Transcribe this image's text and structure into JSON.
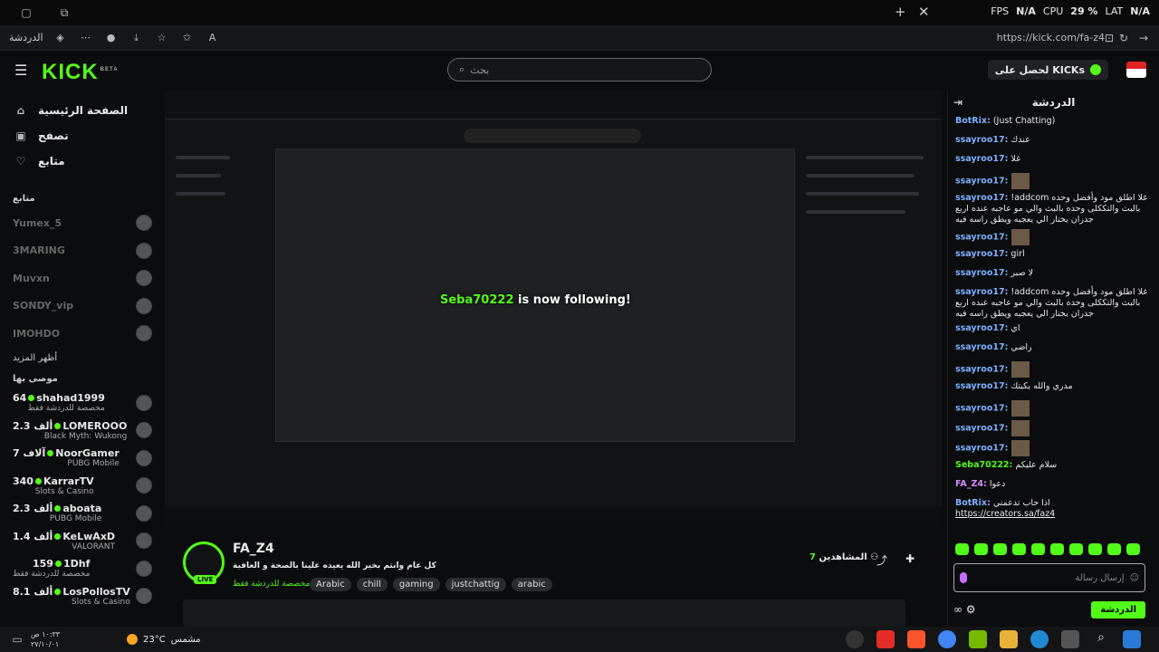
{
  "browser": {
    "tab_ctrl_labels": [
      "+",
      "✕"
    ],
    "hud": {
      "fps_label": "FPS",
      "fps_value": "N/A",
      "cpu_label": "CPU",
      "cpu_value": "29 %",
      "lat_label": "LAT",
      "lat_value": "N/A"
    },
    "chat_tab_label": "الدردشة",
    "url": "https://kick.com/fa-z4"
  },
  "header": {
    "logo_text": "KICK",
    "logo_sup": "BETA",
    "search_placeholder": "بحث",
    "get_kicks_label": "لحصل على KICKs"
  },
  "sidebar": {
    "nav": [
      {
        "label": "الصفحة الرئيسية",
        "icon": "home-icon"
      },
      {
        "label": "تصفح",
        "icon": "browse-icon"
      },
      {
        "label": "متابع",
        "icon": "heart-icon"
      }
    ],
    "following_title": "متابع",
    "following": [
      "Yumex_5",
      "3MARING",
      "Muvxn",
      "SONDY_vip",
      "IMOHDO"
    ],
    "show_more": "أظهر المزيد",
    "recommended_title": "موصى بها",
    "recommended": [
      {
        "name": "shahad1999",
        "count": "64",
        "category": "مخصصة للدردشة فقط"
      },
      {
        "name": "LOMEROOO",
        "count": "2.3 ألف",
        "category": "Black Myth: Wukong"
      },
      {
        "name": "NoorGamer",
        "count": "7 آلاف",
        "category": "PUBG Mobile"
      },
      {
        "name": "KarrarTV",
        "count": "340",
        "category": "Slots & Casino"
      },
      {
        "name": "aboata",
        "count": "2.3 ألف",
        "category": "PUBG Mobile"
      },
      {
        "name": "KeLwAxD",
        "count": "1.4 ألف",
        "category": "VALORANT"
      },
      {
        "name": "1Dhf",
        "count": "159",
        "category": "مخصصة للدردشة فقط"
      },
      {
        "name": "LosPollosTV",
        "count": "8.1 ألف",
        "category": "Slots & Casino"
      }
    ]
  },
  "stream": {
    "follow_user": "Seba70222",
    "follow_text": "is now following!"
  },
  "channel": {
    "name": "FA_Z4",
    "live_badge": "LIVE",
    "title": "كل عام وانتم بخير الله يعيده علينا بالصحة و العافية",
    "category": "مخصصة للدردشة فقط",
    "tags": [
      "Arabic",
      "chill",
      "gaming",
      "justchattig",
      "arabic"
    ],
    "viewers_label": "المشاهدين",
    "viewers_count": "7"
  },
  "chat": {
    "title": "الدردشة",
    "messages": [
      {
        "user": "BotRix:",
        "text": "(Just Chatting)",
        "color": "b"
      },
      {
        "user": "ssayroo17:",
        "text": "عندك",
        "color": "b"
      },
      {
        "user": "ssayroo17:",
        "text": "غلا",
        "color": "b"
      },
      {
        "user": "ssayroo17:",
        "text": "",
        "color": "b",
        "emote": true
      },
      {
        "user": "ssayroo17:",
        "text": "!addcom غلا اطلق مود وأفضل وحده بالبث والتككلى وحده بالبث والي مو عاجبه عنده اربع جدران يختار الي يعجبه ويطق راسه فيه",
        "color": "b"
      },
      {
        "user": "ssayroo17:",
        "text": "",
        "color": "b",
        "emote": true
      },
      {
        "user": "ssayroo17:",
        "text": "girl",
        "color": "b"
      },
      {
        "user": "ssayroo17:",
        "text": "لا صبر",
        "color": "b"
      },
      {
        "user": "ssayroo17:",
        "text": "!addcom غلا اطلق مود وأفضل وحده بالبث والتككلى وحده بالبث والي مو عاجبه عنده اربع جدران يختار الي يعجبه ويطق راسه فيه",
        "color": "b"
      },
      {
        "user": "ssayroo17:",
        "text": "اي",
        "color": "b"
      },
      {
        "user": "ssayroo17:",
        "text": "راضي",
        "color": "b"
      },
      {
        "user": "ssayroo17:",
        "text": "",
        "color": "b",
        "emote": true
      },
      {
        "user": "ssayroo17:",
        "text": "مدري والله يكيتك",
        "color": "b"
      },
      {
        "user": "ssayroo17:",
        "text": "",
        "color": "b",
        "emote": true
      },
      {
        "user": "ssayroo17:",
        "text": "",
        "color": "b",
        "emote": true
      },
      {
        "user": "ssayroo17:",
        "text": "",
        "color": "b",
        "emote": true
      },
      {
        "user": "Seba70222:",
        "text": "سلام عليكم",
        "color": "g"
      },
      {
        "user": "FA_Z4:",
        "text": "دعوا",
        "color": "p"
      },
      {
        "user": "BotRix:",
        "text": "اذا حاب تدعمني",
        "color": "b"
      },
      {
        "user": "",
        "text": "https://creators.sa/faz4",
        "color": "b",
        "link": true
      }
    ],
    "input_placeholder": "إرسال رسالة",
    "send_label": "الدردشة"
  },
  "taskbar": {
    "time": "١٠:٣٣ ص",
    "date": "٢٧/١٠/٠١",
    "weather_temp": "23°C",
    "weather_text": "مشمس"
  }
}
